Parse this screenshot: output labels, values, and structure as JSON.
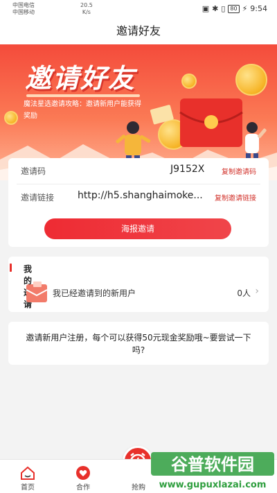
{
  "status_bar": {
    "carrier_1": "中国电信",
    "carrier_2": "中国移动",
    "speed_value": "20.5",
    "speed_unit": "K/s",
    "battery": "80",
    "time": "9:54"
  },
  "header": {
    "title": "邀请好友"
  },
  "banner": {
    "title": "邀请好友",
    "subtitle": "魔法星选邀请攻略：邀请新用户能获得奖励"
  },
  "invite": {
    "code_label": "邀请码",
    "code_value": "J9152X",
    "code_action": "复制邀请码",
    "link_label": "邀请链接",
    "link_value": "http://h5.shanghaimoke...",
    "link_action": "复制邀请链接",
    "poster_button": "海报邀请"
  },
  "my_invites": {
    "title": "我的邀请",
    "row_label": "我已经邀请到的新用户",
    "count": "0人"
  },
  "tip": {
    "text": "邀请新用户注册，每个可以获得50元现金奖励哦~要尝试一下吗?"
  },
  "tabbar": {
    "tabs": [
      {
        "label": "首页",
        "icon": "home-icon"
      },
      {
        "label": "合作",
        "icon": "heart-icon"
      },
      {
        "label": "抢购",
        "icon": "alarm-clock-icon"
      }
    ]
  },
  "watermark": {
    "brand": "谷普软件园",
    "url": "www.gupuxlazai.com"
  },
  "colors": {
    "accent": "#e8302b",
    "banner_top": "#f44b3b",
    "banner_bottom": "#ffb597"
  }
}
